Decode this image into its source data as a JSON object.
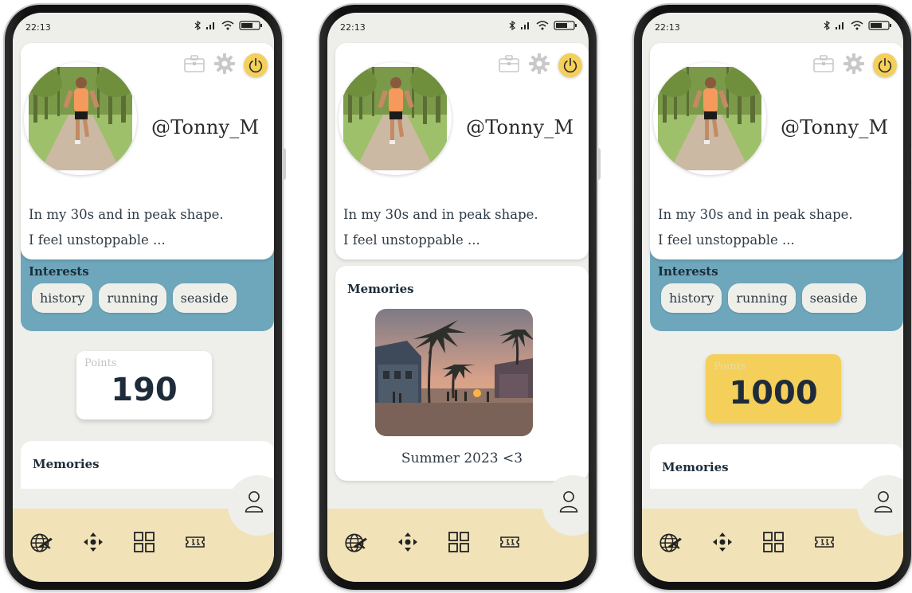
{
  "status": {
    "time": "22:13",
    "battery": "56%"
  },
  "profile": {
    "username": "@Tonny_M",
    "bio_line1": "In my 30s and in peak shape.",
    "bio_line2": "I feel unstoppable ..."
  },
  "interests": {
    "title": "Interests",
    "items": [
      "history",
      "running",
      "seaside"
    ]
  },
  "points": {
    "label": "Points",
    "phone1_value": "190",
    "phone3_value": "1000"
  },
  "memories": {
    "title": "Memories",
    "caption": "Summer 2023 <3"
  },
  "icons": {
    "top": [
      "briefcase-icon",
      "gear-icon",
      "power-icon"
    ],
    "nav": [
      "globe-plane-icon",
      "move-arrows-icon",
      "grid-icon",
      "ticket-icon"
    ],
    "fab": "user-icon"
  },
  "colors": {
    "interests_bg": "#6ea7bc",
    "points_highlight": "#f4cf5a",
    "nav_bg": "#f1e2b8",
    "power": "#f4cf5a"
  }
}
